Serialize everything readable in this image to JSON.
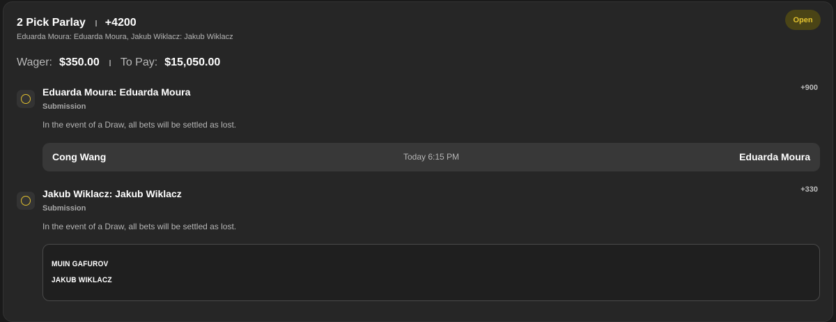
{
  "bet": {
    "title": "2 Pick Parlay",
    "odds": "+4200",
    "selections": "Eduarda Moura: Eduarda Moura, Jakub Wiklacz: Jakub Wiklacz",
    "status": "Open",
    "wager_label": "Wager:",
    "wager_value": "$350.00",
    "topay_label": "To Pay:",
    "topay_value": "$15,050.00"
  },
  "legs": [
    {
      "title": "Eduarda Moura: Eduarda Moura",
      "type": "Submission",
      "note": "In the event of a Draw, all bets will be settled as lost.",
      "odds": "+900",
      "matchup": {
        "fighter_a": "Cong Wang",
        "time": "Today 6:15 PM",
        "fighter_b": "Eduarda Moura"
      }
    },
    {
      "title": "Jakub Wiklacz: Jakub Wiklacz",
      "type": "Submission",
      "note": "In the event of a Draw, all bets will be settled as lost.",
      "odds": "+330",
      "matchup": {
        "fighter_a": "MUIN GAFUROV",
        "fighter_b": "JAKUB WIKLACZ"
      }
    }
  ],
  "colors": {
    "accent": "#e2c12f",
    "card": "#262626",
    "panel": "#383838"
  },
  "icons": {
    "leg_status": "circle-outline-icon"
  }
}
